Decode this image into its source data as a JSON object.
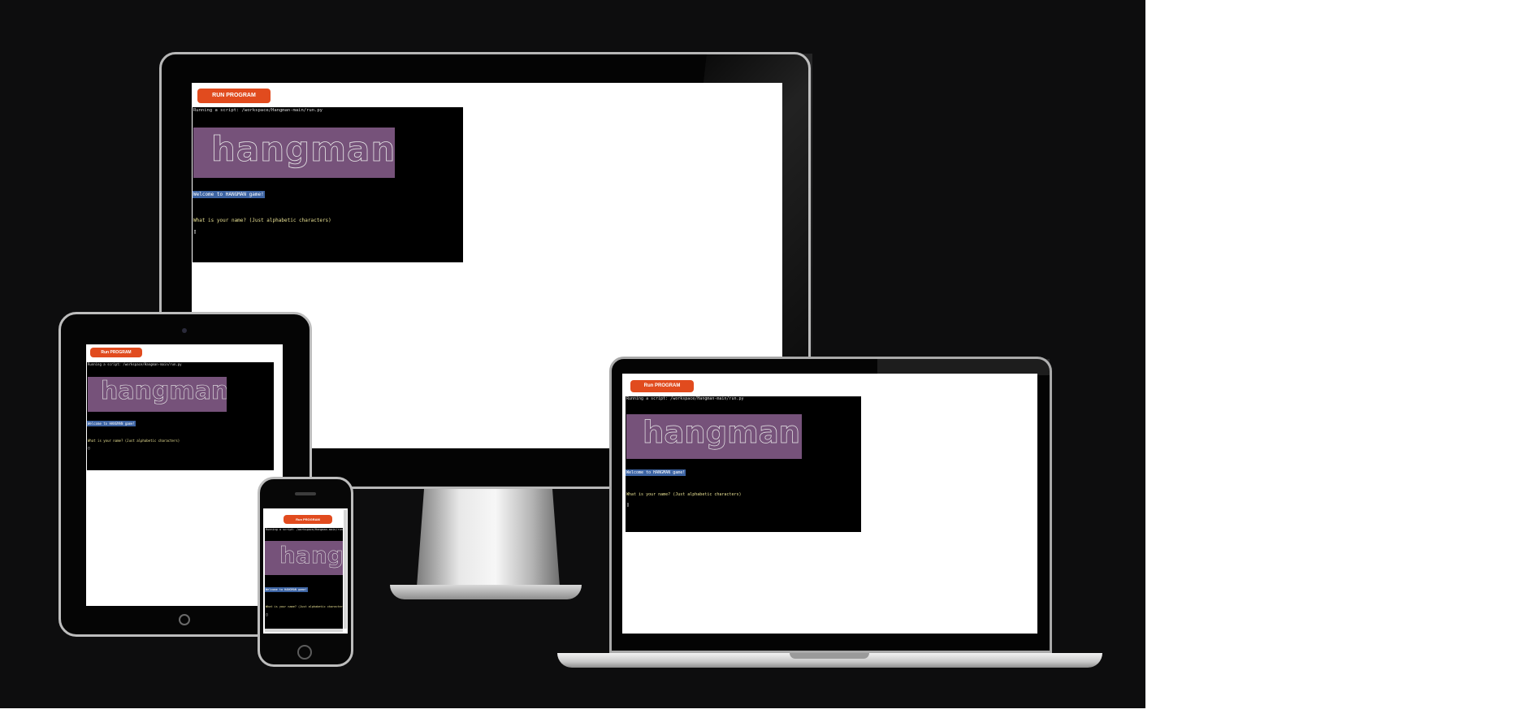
{
  "app": {
    "run_button_label": "RUN PROGRAM",
    "run_button_label_small": "Run PROGRAM",
    "banner_text": "hangman",
    "terminal": {
      "running_line": "Running a script: /workspace/Hangman-main/run.py",
      "welcome_line": "Welcome to HANGMAN game!",
      "prompt_line": "What is your name? (Just alphabetic characters)",
      "cursor": "▯"
    }
  },
  "colors": {
    "backdrop": "#0d0d0e",
    "run_button": "#e14b1e",
    "banner": "#76527a",
    "welcome_highlight": "#3d64a3",
    "prompt_text": "#e8e092"
  }
}
